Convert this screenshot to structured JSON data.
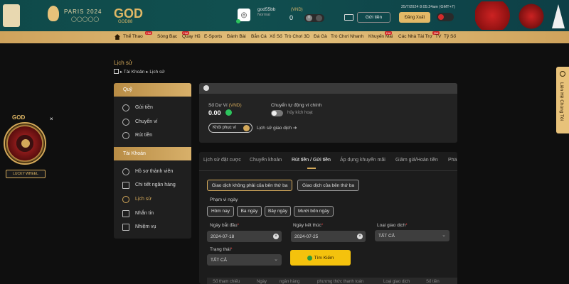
{
  "header": {
    "paris_text": "PARIS 2024",
    "brand": "GOD",
    "brand_sub": "GOD88",
    "username": "god55bb",
    "user_level": "Normal",
    "currency": "(VND)",
    "balance": "0",
    "deposit_btn": "Gửi tiền",
    "logout_btn": "Đăng Xuất",
    "datetime": "25/7/2024 8:05:24am (GMT+7)"
  },
  "nav": {
    "items": [
      "Thể Thao",
      "Sòng Bạc",
      "Quay Hũ",
      "E-Sports",
      "Đánh Bài",
      "Bắn Cá",
      "Xổ Số",
      "Trò Chơi 3D",
      "Đá Gà",
      "Trò Chơi Nhanh",
      "Khuyến Mãi",
      "Các Nhà Tài Trợ",
      "TV",
      "Tỷ Số"
    ],
    "badge": "Hot"
  },
  "page": {
    "title": "Lịch sử",
    "breadcrumb": [
      "Tài Khoản",
      "Lịch sử"
    ]
  },
  "sidebar": {
    "section1": "Quỹ",
    "items1": [
      "Gửi tiền",
      "Chuyển ví",
      "Rút tiền"
    ],
    "section2": "Tài Khoản",
    "items2": [
      "Hồ sơ thành viên",
      "Chi tiết ngân hàng",
      "Lịch sử",
      "Nhắn tin",
      "Nhiệm vụ"
    ]
  },
  "wallet": {
    "balance_label": "Số Dư Ví",
    "currency": "(VND)",
    "balance": "0.00",
    "auto_transfer_label": "Chuyển tự động ví chính",
    "auto_transfer_state": "hủy kích hoạt",
    "restore_btn": "Khôi phục ví",
    "history_link": "Lịch sử giao dịch"
  },
  "tabs": [
    "Lịch sử đặt cược",
    "Chuyển khoản",
    "Rút tiền / Gửi tiền",
    "Áp dụng khuyến mãi",
    "Giảm giá/Hoàn tiền",
    "Phần"
  ],
  "filters": {
    "type_buttons": [
      "Giao dịch không phải của bên thứ ba",
      "Giao dịch của bên thứ ba"
    ],
    "date_range_label": "Phạm vi ngày",
    "date_buttons": [
      "Hôm nay",
      "Ba ngày",
      "Bảy ngày",
      "Mười bốn ngày"
    ],
    "start_label": "Ngày bắt đầu",
    "start_value": "2024-07-18",
    "end_label": "Ngày kết thúc",
    "end_value": "2024-07-25",
    "type_label": "Loại giao dịch",
    "type_value": "TẤT CẢ",
    "status_label": "Trạng thái",
    "status_value": "TẤT CẢ",
    "search_btn": "Tìm Kiếm"
  },
  "table_headers": [
    "Số tham chiếu",
    "Ngày",
    "ngân hàng",
    "phương thức thanh toán",
    "Loại giao dịch",
    "Số tiền"
  ],
  "lucky_wheel": {
    "label": "LUCKY WHEEL",
    "brand": "GOD"
  },
  "side_contact": "Liên Hệ Chúng Tôi",
  "colors": {
    "gold": "#d4a95a",
    "teal": "#114f4f",
    "yellow_btn": "#f4c20d"
  }
}
